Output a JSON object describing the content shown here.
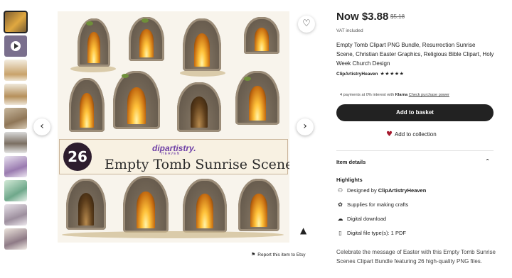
{
  "gallery": {
    "thumbnail_count": 10,
    "active_index": 0,
    "banner": {
      "count": "26",
      "brand": "dipartistry.",
      "brand_sub": "HEAVEN",
      "title": "Empty Tomb Sunrise Scenes"
    },
    "report_label": "Report this item to Etsy"
  },
  "icons": {
    "prev": "chevron-left-icon",
    "next": "chevron-right-icon",
    "favorite": "heart-outline-icon",
    "platform": "platform-logo-icon",
    "report": "flag-icon"
  },
  "listing": {
    "price": "Now $3.88",
    "original_price": "$5.18",
    "vat_note": "VAT included",
    "title": "Empty Tomb Clipart PNG Bundle, Resurrection Sunrise Scene, Christian Easter Graphics, Religious Bible Clipart, Holy Week Church Design",
    "shop_name": "ClipArtistryHeaven",
    "rating": 5,
    "klarna": {
      "prefix": "4 payments at 0% interest with",
      "brand": "Klarna",
      "link": "Check purchase power"
    },
    "add_to_basket": "Add to basket",
    "add_to_collection": "Add to collection"
  },
  "details": {
    "heading": "Item details",
    "highlights_heading": "Highlights",
    "highlights": [
      {
        "icon": "designer-icon",
        "prefix": "Designed by ",
        "value": "ClipArtistryHeaven"
      },
      {
        "icon": "craft-supplies-icon",
        "prefix": "Supplies for making crafts",
        "value": ""
      },
      {
        "icon": "cloud-download-icon",
        "prefix": "Digital download",
        "value": ""
      },
      {
        "icon": "file-icon",
        "prefix": "Digital file type(s): 1 PDF",
        "value": ""
      }
    ],
    "description": "Celebrate the message of Easter with this Empty Tomb Sunrise Scenes Clipart Bundle featuring 26 high-quality PNG files."
  },
  "colors": {
    "button_dark": "#222222",
    "heart_red": "#a61a2e",
    "brand_purple": "#6e3fa6",
    "badge_dark": "#2d1d2e"
  }
}
